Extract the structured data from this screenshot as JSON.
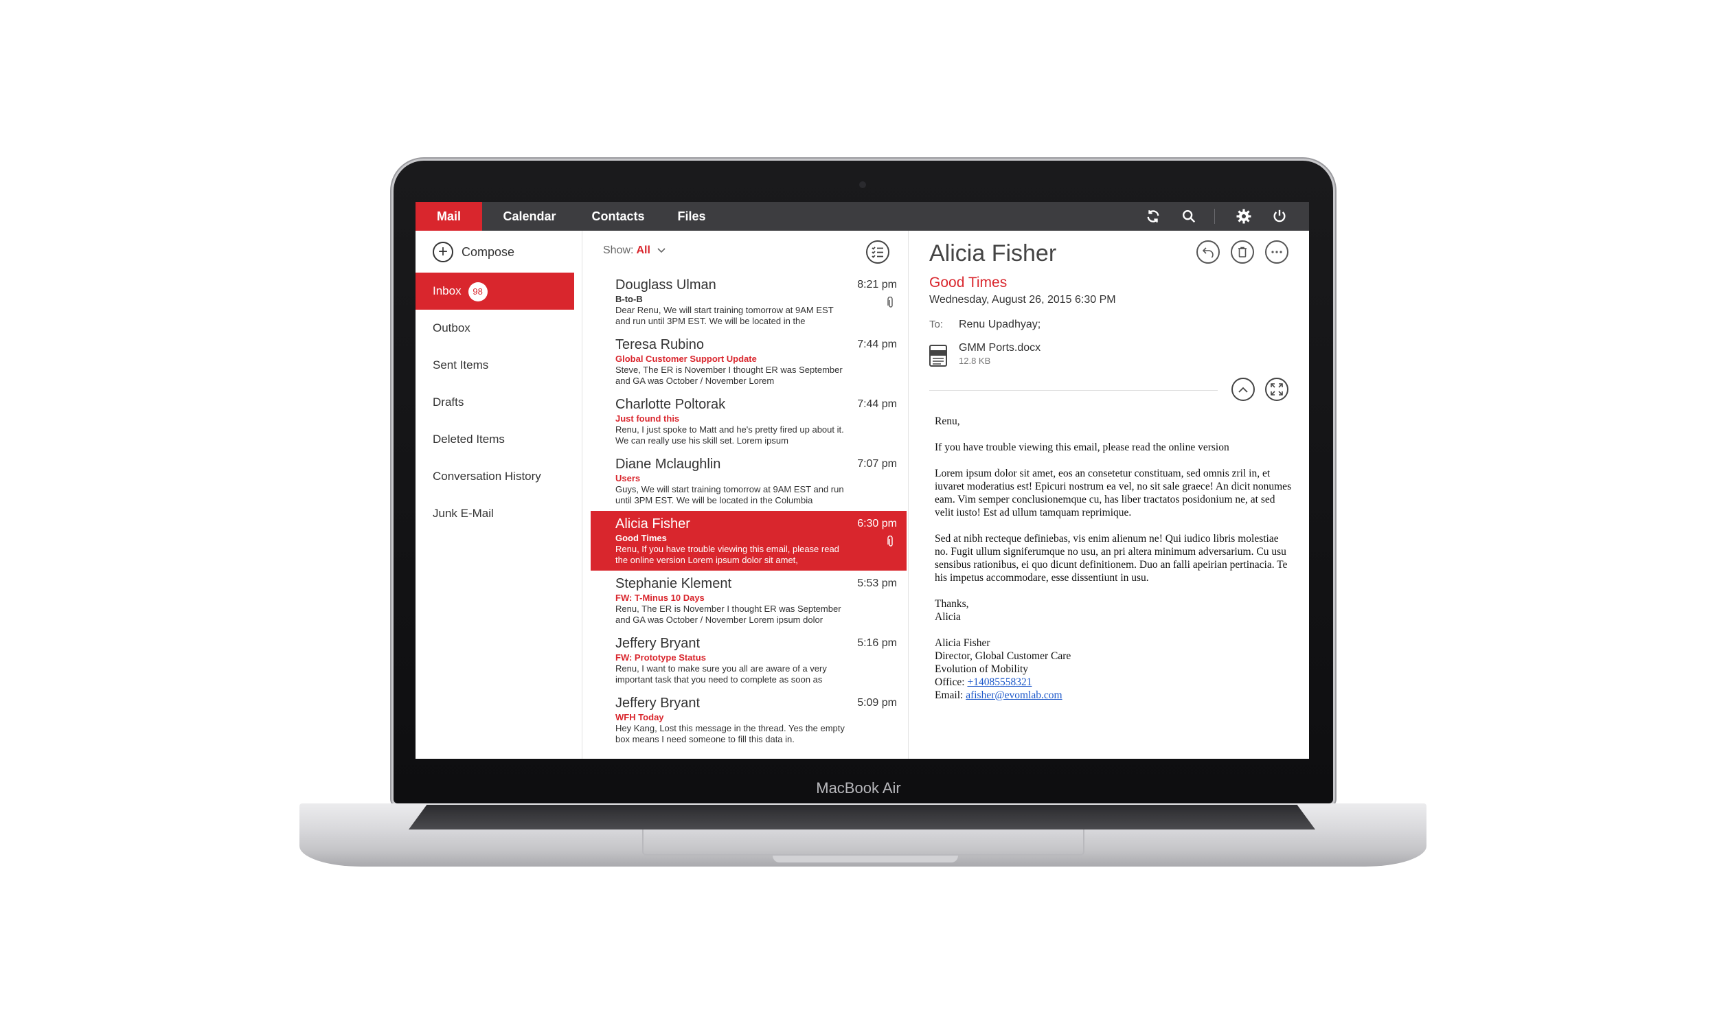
{
  "device": {
    "label": "MacBook Air"
  },
  "nav": {
    "tabs": [
      {
        "label": "Mail",
        "active": true
      },
      {
        "label": "Calendar",
        "active": false
      },
      {
        "label": "Contacts",
        "active": false
      },
      {
        "label": "Files",
        "active": false
      }
    ],
    "icons": [
      "refresh-icon",
      "search-icon",
      "settings-icon",
      "power-icon"
    ]
  },
  "colors": {
    "accent": "#d9262d",
    "topbar": "#3d3d40"
  },
  "sidebar": {
    "compose_label": "Compose",
    "folders": [
      {
        "label": "Inbox",
        "badge": "98",
        "active": true
      },
      {
        "label": "Outbox"
      },
      {
        "label": "Sent Items"
      },
      {
        "label": "Drafts"
      },
      {
        "label": "Deleted Items"
      },
      {
        "label": "Conversation History"
      },
      {
        "label": "Junk E-Mail"
      }
    ]
  },
  "list": {
    "show_label": "Show:",
    "show_value": "All",
    "messages": [
      {
        "sender": "Douglass Ulman",
        "time": "8:21 pm",
        "subject": "B-to-B",
        "preview": "Dear Renu, We will start training tomorrow at 9AM EST and run until 3PM EST. We will be located in the",
        "attachment": true
      },
      {
        "sender": "Teresa Rubino",
        "time": "7:44 pm",
        "subject": "Global Customer Support Update",
        "preview": "Steve, The ER is November I thought ER was September and GA was October / November Lorem",
        "attachment": false
      },
      {
        "sender": "Charlotte Poltorak",
        "time": "7:44 pm",
        "subject": "Just found this",
        "preview": "Renu, I just spoke to Matt and he's pretty fired up about it. We can really use his skill set. Lorem ipsum",
        "attachment": false
      },
      {
        "sender": "Diane Mclaughlin",
        "time": "7:07 pm",
        "subject": "Users",
        "preview": "Guys, We will start training tomorrow at 9AM EST and run until 3PM EST. We will be located in the Columbia",
        "attachment": false
      },
      {
        "sender": "Alicia Fisher",
        "time": "6:30 pm",
        "subject": "Good Times",
        "preview": "Renu, If you have trouble viewing this email, please read the online version Lorem ipsum dolor sit amet,",
        "attachment": true,
        "selected": true
      },
      {
        "sender": "Stephanie Klement",
        "time": "5:53 pm",
        "subject": "FW: T-Minus 10 Days",
        "preview": "Renu, The ER is November I thought ER was September and GA was October / November Lorem ipsum dolor",
        "attachment": false
      },
      {
        "sender": "Jeffery Bryant",
        "time": "5:16 pm",
        "subject": "FW: Prototype Status",
        "preview": "Renu, I want to make sure you all are aware of a very important task that you need to complete as soon as",
        "attachment": false
      },
      {
        "sender": "Jeffery Bryant",
        "time": "5:09 pm",
        "subject": "WFH Today",
        "preview": "Hey Kang, Lost this message in the thread. Yes the empty box means I need someone to fill this data in.",
        "attachment": false
      }
    ]
  },
  "reader": {
    "sender": "Alicia Fisher",
    "subject": "Good Times",
    "date": "Wednesday, August 26, 2015 6:30 PM",
    "to_label": "To:",
    "to": "Renu Upadhyay;",
    "attachment": {
      "name": "GMM Ports.docx",
      "size": "12.8 KB"
    },
    "body": {
      "greeting": "Renu,",
      "line1": "If you have trouble viewing this email, please read the online version",
      "para1": "Lorem ipsum dolor sit amet, eos an consetetur constituam, sed omnis zril in, et iuvaret moderatius est! Epicuri nostrum ea vel, no sit sale graece! An dicit nonumes eam. Vim semper conclusionemque cu, has liber tractatos posidonium ne, at sed velit iusto! Est ad ullum tamquam reprimique.",
      "para2": "Sed at nibh recteque definiebas, vis enim alienum ne! Qui iudico libris molestiae no. Fugit ullum signiferumque no usu, an pri altera minimum adversarium. Cu usu sensibus rationibus, ei quo dicunt definitionem. Duo an falli apeirian pertinacia. Te his impetus accommodare, esse dissentiunt in usu.",
      "thanks": "Thanks,",
      "thanks_name": "Alicia",
      "sig_name": "Alicia Fisher",
      "sig_title": "Director, Global Customer Care",
      "sig_company": "Evolution of Mobility",
      "office_label": "Office:",
      "office": "+14085558321",
      "email_label": "Email:",
      "email": "afisher@evomlab.com"
    }
  }
}
